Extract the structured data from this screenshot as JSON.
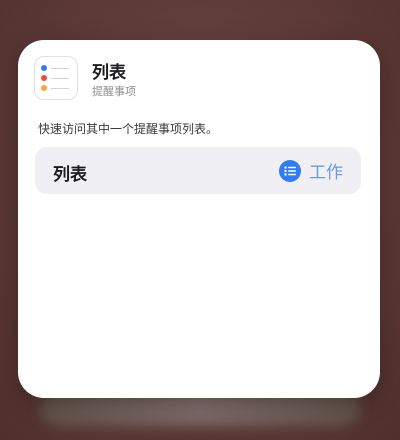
{
  "widget": {
    "app_title": "列表",
    "app_subtitle": "提醒事项",
    "description": "快速访问其中一个提醒事项列表。",
    "parameter": {
      "label": "列表",
      "value": "工作",
      "value_icon": "list-bullet-icon"
    },
    "app_icon": "reminders-app-icon"
  },
  "colors": {
    "accent": "#2f7cf6",
    "value_text": "#6b9cd8",
    "icon_dots": [
      "#2f7cf6",
      "#f04a3f",
      "#f7a53a"
    ]
  }
}
